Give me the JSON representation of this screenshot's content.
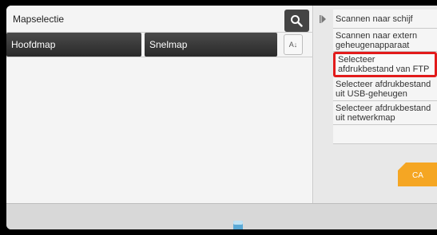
{
  "header": {
    "title": "Mapselectie"
  },
  "folders": [
    {
      "label": "Hoofdmap"
    },
    {
      "label": "Snelmap"
    }
  ],
  "sort": {
    "label": "A↓"
  },
  "menu": {
    "items": [
      {
        "label": "Scannen naar schijf"
      },
      {
        "label": "Scannen naar extern geheugenapparaat"
      },
      {
        "label": "Selecteer afdrukbestand van FTP",
        "selected": true
      },
      {
        "label": "Selecteer afdrukbestand uit USB-geheugen"
      },
      {
        "label": "Selecteer afdrukbestand uit netwerkmap"
      },
      {
        "label": ""
      }
    ]
  },
  "ca_button": {
    "label": "CA"
  },
  "colors": {
    "accent": "#e21b1b",
    "ca": "#f5a623",
    "dark_button": "#333333"
  },
  "icons": {
    "search": "search-icon",
    "sort": "sort-icon",
    "arrow": "play-arrow-icon",
    "bottom": "storage-icon"
  }
}
